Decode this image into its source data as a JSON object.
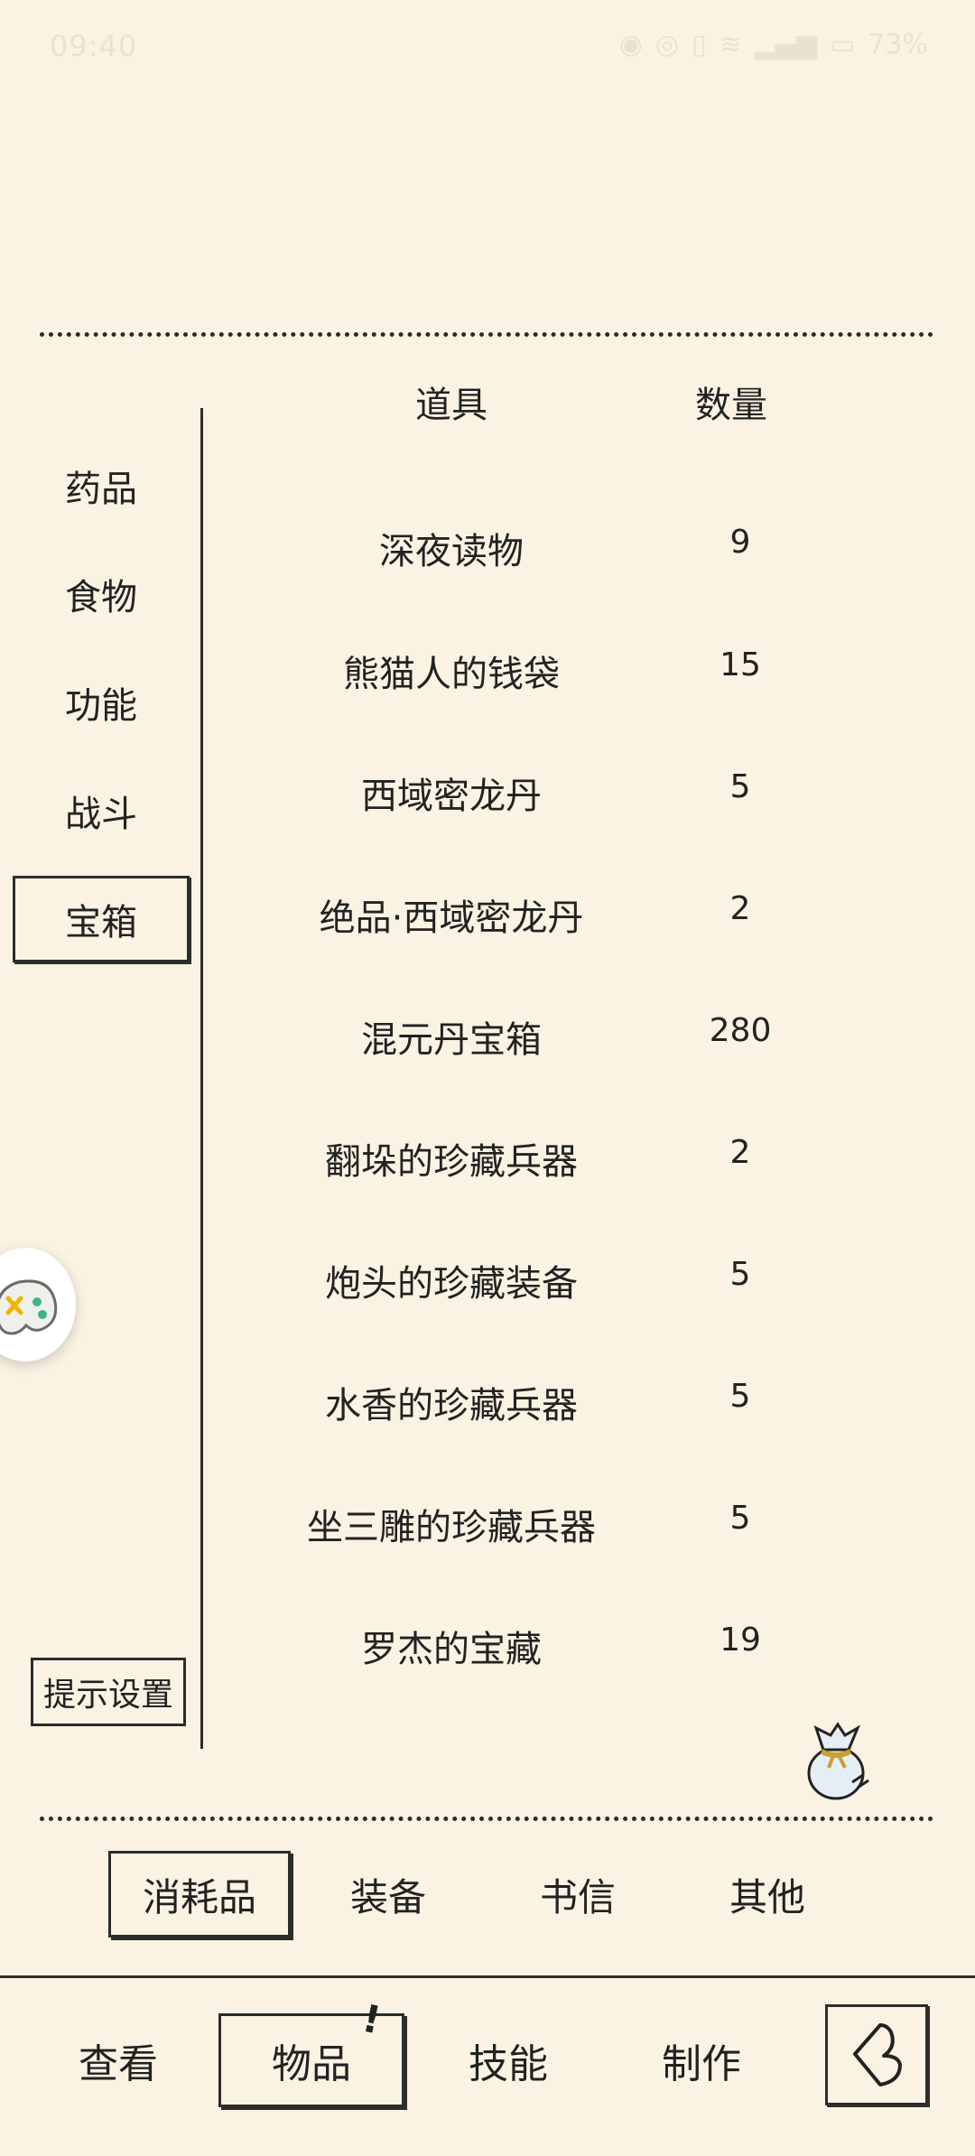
{
  "status_bar": {
    "time": "09:40",
    "battery": "73%",
    "icons": [
      "alarm-icon",
      "eye-icon",
      "vibrate-icon",
      "wifi-icon",
      "signal-icon",
      "battery-icon"
    ]
  },
  "table": {
    "col_item": "道具",
    "col_qty": "数量"
  },
  "categories": [
    {
      "label": "药品"
    },
    {
      "label": "食物"
    },
    {
      "label": "功能"
    },
    {
      "label": "战斗"
    },
    {
      "label": "宝箱",
      "active": true
    }
  ],
  "hint_button": "提示设置",
  "items": [
    {
      "name": "深夜读物",
      "qty": "9"
    },
    {
      "name": "熊猫人的钱袋",
      "qty": "15"
    },
    {
      "name": "西域密龙丹",
      "qty": "5"
    },
    {
      "name": "绝品·西域密龙丹",
      "qty": "2"
    },
    {
      "name": "混元丹宝箱",
      "qty": "280"
    },
    {
      "name": "翻垛的珍藏兵器",
      "qty": "2"
    },
    {
      "name": "炮头的珍藏装备",
      "qty": "5"
    },
    {
      "name": "水香的珍藏兵器",
      "qty": "5"
    },
    {
      "name": "坐三雕的珍藏兵器",
      "qty": "5"
    },
    {
      "name": "罗杰的宝藏",
      "qty": "19"
    }
  ],
  "sub_tabs": [
    {
      "label": "消耗品",
      "active": true
    },
    {
      "label": "装备"
    },
    {
      "label": "书信"
    },
    {
      "label": "其他"
    }
  ],
  "nav_tabs": [
    {
      "label": "查看"
    },
    {
      "label": "物品",
      "active": true
    },
    {
      "label": "技能"
    },
    {
      "label": "制作"
    }
  ],
  "alert_mark": "!",
  "colors": {
    "background": "#faf3e3",
    "ink": "#2c2c2c"
  }
}
